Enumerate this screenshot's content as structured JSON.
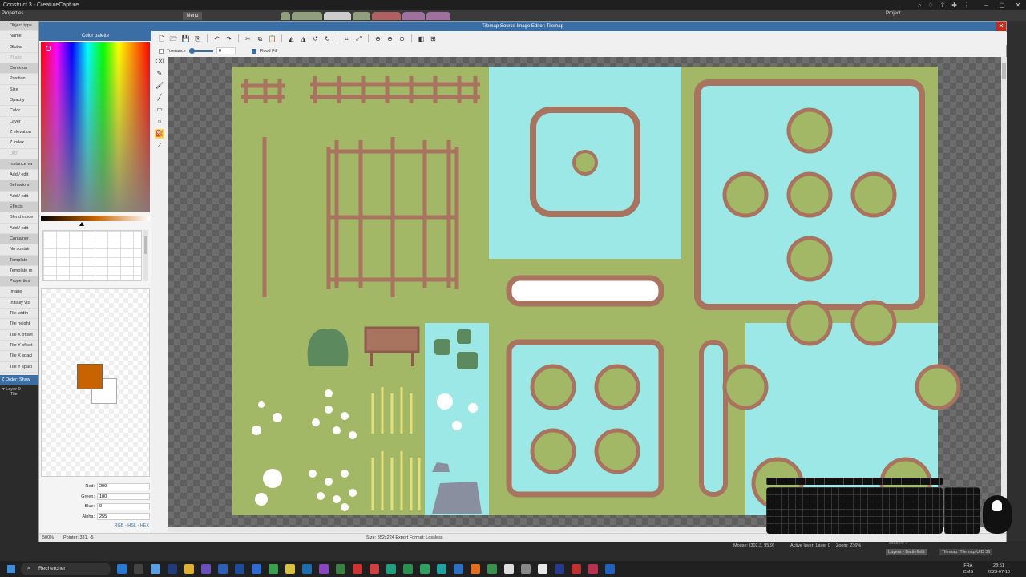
{
  "app": {
    "window_title": "Construct 3 - CreatureCapture",
    "menu_label": "Menu",
    "properties_header": "Properties",
    "project_header": "Project",
    "layout_tabs": [
      "",
      "",
      "",
      "",
      "",
      "",
      ""
    ],
    "accent": "#3a6ea5"
  },
  "properties": {
    "rows": [
      "Object type",
      "Name",
      "Global",
      "Plugin",
      "Common",
      "Position",
      "Size",
      "Opacity",
      "Color",
      "Layer",
      "Z elevation",
      "Z index",
      "UID",
      "Instance va",
      "Add / edit",
      "Behaviors",
      "Add / edit",
      "Effects",
      "Blend mode",
      "Add / edit",
      "Container",
      "No contain",
      "Template",
      "Template m",
      "Properties",
      "Image",
      "Initially visi",
      "Tile width",
      "Tile height",
      "Tile X offset",
      "Tile Y offset",
      "Tile X spaci",
      "Tile Y spaci"
    ],
    "zorder_label": "Z Order: Show",
    "tree": [
      "Layer 0",
      "Tile"
    ]
  },
  "editor": {
    "title": "Tilemap Source Image Editor: Tilemap",
    "close_icon": "close-icon",
    "tool_options": {
      "tolerance_label": "Tolerance",
      "tolerance_value": "0",
      "flood_fill_label": "Flood Fill",
      "tolerance_fraction": 0.0
    },
    "status": {
      "zoom": "500%",
      "pointer": "Pointer: 331, -5",
      "size_export": "Size: 352x224   Export Format: Lossless"
    }
  },
  "palette": {
    "title": "Color palette",
    "primary_color": "#c86400",
    "secondary_color": "#ffffff",
    "red_label": "Red:",
    "red": "200",
    "green_label": "Green:",
    "green": "100",
    "blue_label": "Blue:",
    "blue": "0",
    "alpha_label": "Alpha:",
    "alpha": "255",
    "modes": "RGB - HSL - HEX"
  },
  "bottom": {
    "mouse": "Mouse: (302.3, 95.9)",
    "active_layer": "Active layer: Layer 0",
    "zoom": "Zoom: 236%",
    "rotation": "Rotation: 0",
    "tabs": [
      "Layers - Battlefield",
      "Tilemap: Tilemap UID 36 "
    ]
  },
  "taskbar": {
    "search": "Rechercher",
    "lang1": "FRA",
    "lang2": "CMS",
    "time": "23:51",
    "date": "2023-07-18"
  }
}
